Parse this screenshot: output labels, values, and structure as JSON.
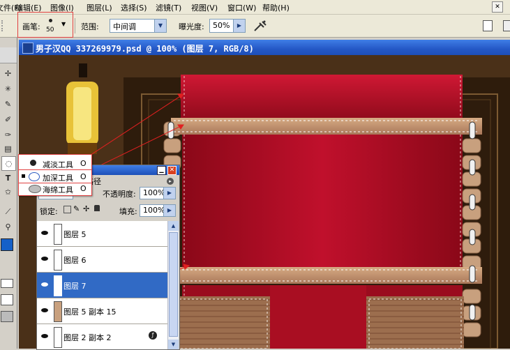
{
  "menu": [
    {
      "label": "文件(F)"
    },
    {
      "label": "编辑(E)"
    },
    {
      "label": "图像(I)"
    },
    {
      "label": "图层(L)"
    },
    {
      "label": "选择(S)"
    },
    {
      "label": "滤镜(T)"
    },
    {
      "label": "视图(V)"
    },
    {
      "label": "窗口(W)"
    },
    {
      "label": "帮助(H)"
    }
  ],
  "options": {
    "brush_label": "画笔:",
    "brush_size": "50",
    "range_label": "范围:",
    "range_value": "中间调",
    "exposure_label": "曝光度:",
    "exposure_value": "50%"
  },
  "document": {
    "title": "男子汉QQ 337269979.psd @ 100% (图层 7, RGB/8)"
  },
  "flyout": [
    {
      "label": "减淡工具",
      "key": "O"
    },
    {
      "label": "加深工具",
      "key": "O"
    },
    {
      "label": "海绵工具",
      "key": "O"
    }
  ],
  "layers_panel": {
    "tab_paths": "路径",
    "opacity_label": "不透明度:",
    "opacity_value": "100%",
    "lock_label": "锁定:",
    "fill_label": "填充:",
    "fill_value": "100%",
    "layers": [
      {
        "name": "图层 5"
      },
      {
        "name": "图层 6"
      },
      {
        "name": "图层 7"
      },
      {
        "name": "图层 5 副本 15"
      },
      {
        "name": "图层 2 副本 2"
      }
    ]
  },
  "colors": {
    "accent": "#316ac5",
    "ribbon_red": "#b8102a",
    "strap_tan": "#c79a74",
    "annotation_red": "#e02020"
  }
}
